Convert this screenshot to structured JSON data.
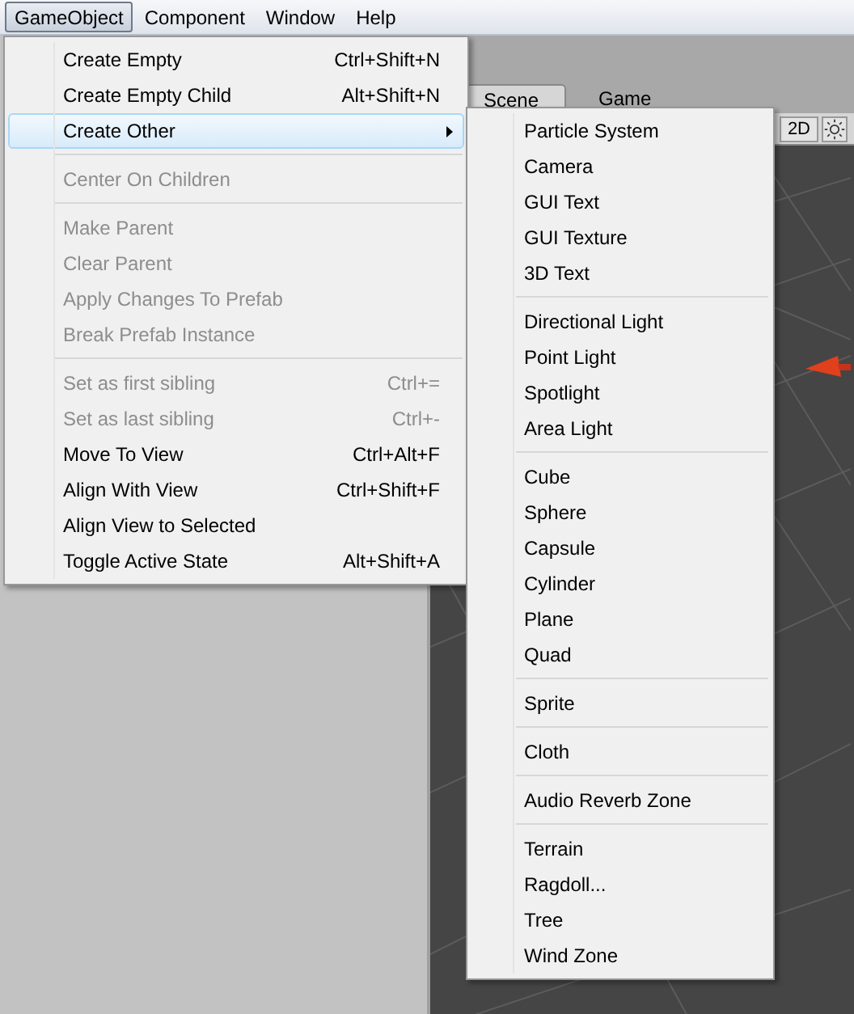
{
  "menu_bar": [
    {
      "label": "GameObject",
      "selected": true
    },
    {
      "label": "Component",
      "selected": false
    },
    {
      "label": "Window",
      "selected": false
    },
    {
      "label": "Help",
      "selected": false
    }
  ],
  "scene_tabs": [
    {
      "label": "Scene",
      "selected": true
    },
    {
      "label": "Game",
      "selected": false
    }
  ],
  "scene_toolbar": {
    "mode_button": "2D"
  },
  "menu": {
    "items": [
      {
        "kind": "item",
        "label": "Create Empty",
        "shortcut": "Ctrl+Shift+N",
        "disabled": false,
        "selected": false
      },
      {
        "kind": "item",
        "label": "Create Empty Child",
        "shortcut": "Alt+Shift+N",
        "disabled": false,
        "selected": false
      },
      {
        "kind": "submenu",
        "label": "Create Other",
        "disabled": false,
        "selected": true
      },
      {
        "kind": "separator"
      },
      {
        "kind": "item",
        "label": "Center On Children",
        "disabled": true,
        "selected": false
      },
      {
        "kind": "separator"
      },
      {
        "kind": "item",
        "label": "Make Parent",
        "disabled": true,
        "selected": false
      },
      {
        "kind": "item",
        "label": "Clear Parent",
        "disabled": true,
        "selected": false
      },
      {
        "kind": "item",
        "label": "Apply Changes To Prefab",
        "disabled": true,
        "selected": false
      },
      {
        "kind": "item",
        "label": "Break Prefab Instance",
        "disabled": true,
        "selected": false
      },
      {
        "kind": "separator"
      },
      {
        "kind": "item",
        "label": "Set as first sibling",
        "shortcut": "Ctrl+=",
        "disabled": true,
        "selected": false
      },
      {
        "kind": "item",
        "label": "Set as last sibling",
        "shortcut": "Ctrl+-",
        "disabled": true,
        "selected": false
      },
      {
        "kind": "item",
        "label": "Move To View",
        "shortcut": "Ctrl+Alt+F",
        "disabled": false,
        "selected": false
      },
      {
        "kind": "item",
        "label": "Align With View",
        "shortcut": "Ctrl+Shift+F",
        "disabled": false,
        "selected": false
      },
      {
        "kind": "item",
        "label": "Align View to Selected",
        "disabled": false,
        "selected": false
      },
      {
        "kind": "item",
        "label": "Toggle Active State",
        "shortcut": "Alt+Shift+A",
        "disabled": false,
        "selected": false
      }
    ]
  },
  "submenu": {
    "items": [
      {
        "kind": "item",
        "label": "Particle System"
      },
      {
        "kind": "item",
        "label": "Camera"
      },
      {
        "kind": "item",
        "label": "GUI Text"
      },
      {
        "kind": "item",
        "label": "GUI Texture"
      },
      {
        "kind": "item",
        "label": "3D Text"
      },
      {
        "kind": "separator"
      },
      {
        "kind": "item",
        "label": "Directional Light"
      },
      {
        "kind": "item",
        "label": "Point Light"
      },
      {
        "kind": "item",
        "label": "Spotlight"
      },
      {
        "kind": "item",
        "label": "Area Light"
      },
      {
        "kind": "separator"
      },
      {
        "kind": "item",
        "label": "Cube"
      },
      {
        "kind": "item",
        "label": "Sphere"
      },
      {
        "kind": "item",
        "label": "Capsule"
      },
      {
        "kind": "item",
        "label": "Cylinder"
      },
      {
        "kind": "item",
        "label": "Plane"
      },
      {
        "kind": "item",
        "label": "Quad"
      },
      {
        "kind": "separator"
      },
      {
        "kind": "item",
        "label": "Sprite"
      },
      {
        "kind": "separator"
      },
      {
        "kind": "item",
        "label": "Cloth"
      },
      {
        "kind": "separator"
      },
      {
        "kind": "item",
        "label": "Audio Reverb Zone"
      },
      {
        "kind": "separator"
      },
      {
        "kind": "item",
        "label": "Terrain"
      },
      {
        "kind": "item",
        "label": "Ragdoll..."
      },
      {
        "kind": "item",
        "label": "Tree"
      },
      {
        "kind": "item",
        "label": "Wind Zone"
      }
    ]
  }
}
